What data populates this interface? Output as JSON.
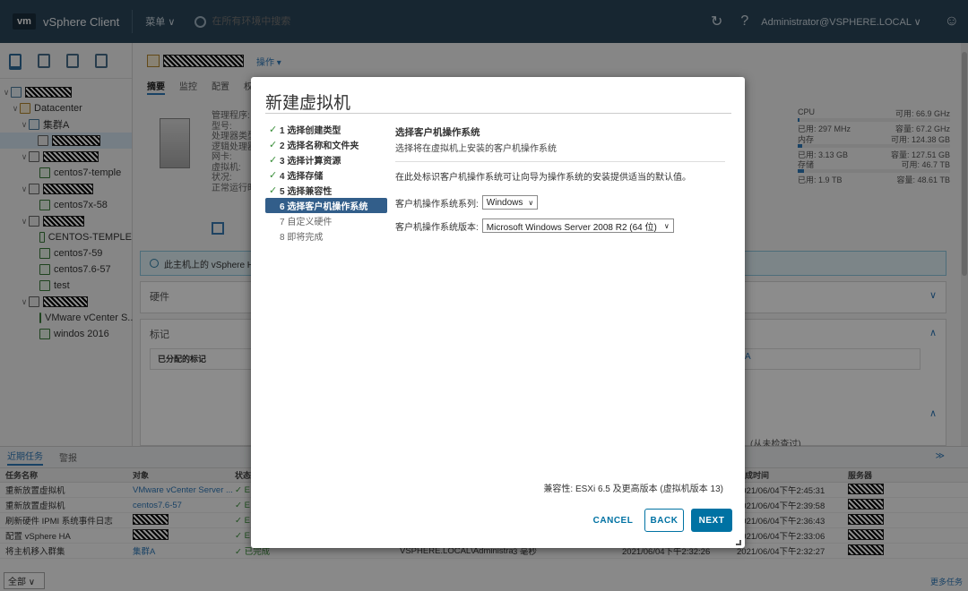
{
  "topbar": {
    "logo": "vm",
    "title": "vSphere Client",
    "menu_label": "菜单 ∨",
    "search_placeholder": "在所有环境中搜索",
    "user": "Administrator@VSPHERE.LOCAL ∨"
  },
  "tree": [
    {
      "label": "Datacenter"
    },
    {
      "label": "集群A"
    },
    {
      "label": "centos7-temple"
    },
    {
      "label": "centos7x-58"
    },
    {
      "label": "CENTOS-TEMPLE"
    },
    {
      "label": "centos7-59"
    },
    {
      "label": "centos7.6-57"
    },
    {
      "label": "test"
    },
    {
      "label": "VMware vCenter S..."
    },
    {
      "label": "windos 2016"
    }
  ],
  "main": {
    "actions": "操作 ▾",
    "tabs": [
      "摘要",
      "监控",
      "配置",
      "权"
    ],
    "props": [
      "管理程序:",
      "型号:",
      "处理器类型:",
      "逻辑处理器:",
      "网卡:",
      "虚拟机:",
      "状况:",
      "正常运行时"
    ],
    "ha_banner": "此主机上的 vSphere HA",
    "hardware": "硬件",
    "tags_title": "标记",
    "assigned_tags": "已分配的标记",
    "ha_fragment": "A",
    "last_checked": "(从未检查过)",
    "resources": {
      "cpu_label": "CPU",
      "cpu_free": "可用: 66.9 GHz",
      "cpu_used": "已用: 297 MHz",
      "cpu_cap": "容量: 67.2 GHz",
      "mem_label": "内存",
      "mem_free": "可用: 124.38 GB",
      "mem_used": "已用: 3.13 GB",
      "mem_cap": "容量: 127.51 GB",
      "sto_label": "存储",
      "sto_free": "可用: 46.7 TB",
      "sto_used": "已用: 1.9 TB",
      "sto_cap": "容量: 48.61 TB"
    }
  },
  "tasks": {
    "tabs": [
      "近期任务",
      "警报"
    ],
    "headers": [
      "任务名称",
      "对象",
      "状态",
      "",
      "",
      "",
      "完成时间",
      "服务器"
    ],
    "rows": [
      {
        "name": "重新放置虚拟机",
        "object": "VMware vCenter Server ...",
        "status": "✓ E",
        "initiator": "",
        "queued": "",
        "start": "",
        "done": "2021/06/04下午2:45:31"
      },
      {
        "name": "重新放置虚拟机",
        "object": "centos7.6-57",
        "status": "✓ E",
        "initiator": "",
        "queued": "",
        "start": "",
        "done": "2021/06/04下午2:39:58"
      },
      {
        "name": "刷新硬件 IPMI 系统事件日志",
        "object": "",
        "status": "✓ E",
        "initiator": "",
        "queued": "",
        "start": "",
        "done": "2021/06/04下午2:36:43"
      },
      {
        "name": "配置 vSphere HA",
        "object": "",
        "status": "✓ E",
        "initiator": "",
        "queued": "",
        "start": "",
        "done": "2021/06/04下午2:33:06"
      },
      {
        "name": "将主机移入群集",
        "object": "集群A",
        "status": "✓ 已完成",
        "initiator": "VSPHERE.LOCAL\\Administra...",
        "queued": "3 毫秒",
        "start": "2021/06/04下午2:32:26",
        "done": "2021/06/04下午2:32:27"
      }
    ],
    "filter": "全部",
    "more": "更多任务"
  },
  "dialog": {
    "title": "新建虚拟机",
    "steps": [
      {
        "label": "1 选择创建类型",
        "state": "done"
      },
      {
        "label": "2 选择名称和文件夹",
        "state": "done"
      },
      {
        "label": "3 选择计算资源",
        "state": "done"
      },
      {
        "label": "4 选择存储",
        "state": "done"
      },
      {
        "label": "5 选择兼容性",
        "state": "done"
      },
      {
        "label": "6 选择客户机操作系统",
        "state": "active"
      },
      {
        "label": "7 自定义硬件",
        "state": "todo"
      },
      {
        "label": "8 即将完成",
        "state": "todo"
      }
    ],
    "section_title": "选择客户机操作系统",
    "section_sub": "选择将在虚拟机上安装的客户机操作系统",
    "description": "在此处标识客户机操作系统可让向导为操作系统的安装提供适当的默认值。",
    "os_family_label": "客户机操作系统系列:",
    "os_family_value": "Windows",
    "os_version_label": "客户机操作系统版本:",
    "os_version_value": "Microsoft Windows Server 2008 R2 (64 位)",
    "compat": "兼容性: ESXi 6.5 及更高版本 (虚拟机版本 13)",
    "cancel": "CANCEL",
    "back": "BACK",
    "next": "NEXT"
  }
}
